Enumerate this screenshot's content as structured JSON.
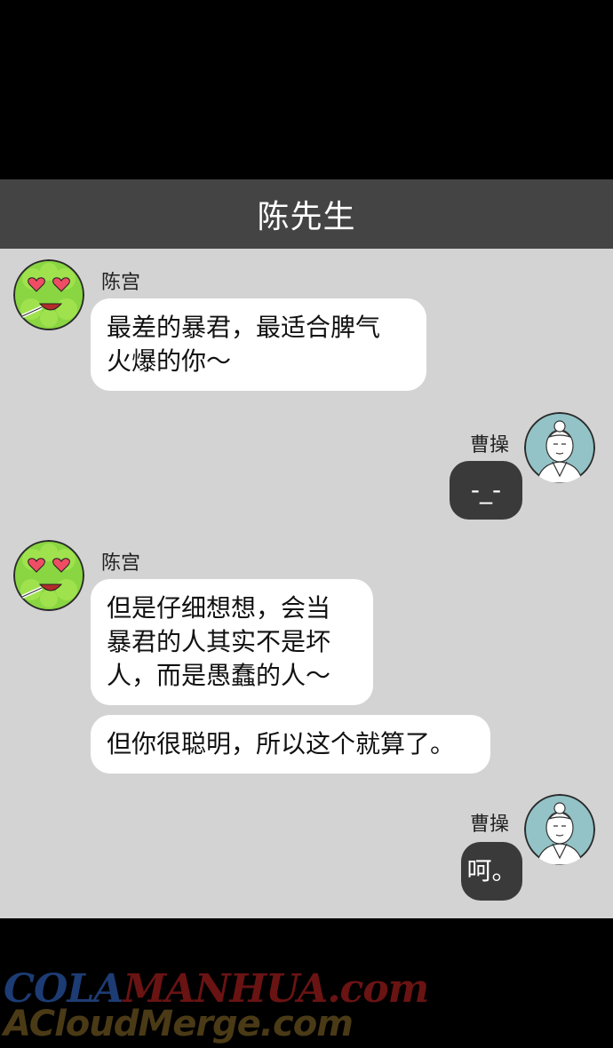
{
  "header": {
    "title": "陈先生"
  },
  "messages": [
    {
      "sender": "陈宫",
      "side": "left",
      "avatar": "green-emoji-avatar",
      "bubbles": [
        "最差的暴君，最适合脾气\n火爆的你～"
      ]
    },
    {
      "sender": "曹操",
      "side": "right",
      "avatar": "caocao-avatar",
      "bubbles": [
        "-_-"
      ]
    },
    {
      "sender": "陈宫",
      "side": "left",
      "avatar": "green-emoji-avatar",
      "bubbles": [
        "但是仔细想想，会当\n暴君的人其实不是坏\n人，而是愚蠢的人～",
        "但你很聪明，所以这个就算了。"
      ]
    },
    {
      "sender": "曹操",
      "side": "right",
      "avatar": "caocao-avatar",
      "bubbles": [
        "呵。"
      ]
    }
  ],
  "watermark": {
    "line1_part1": "COLA",
    "line1_part2": "MANHUA.com",
    "line2": "ACloudMerge.com"
  },
  "colors": {
    "title_bar": "#444444",
    "chat_bg": "#d3d3d3",
    "bubble_left": "#ffffff",
    "bubble_right": "#3a3a3a"
  }
}
